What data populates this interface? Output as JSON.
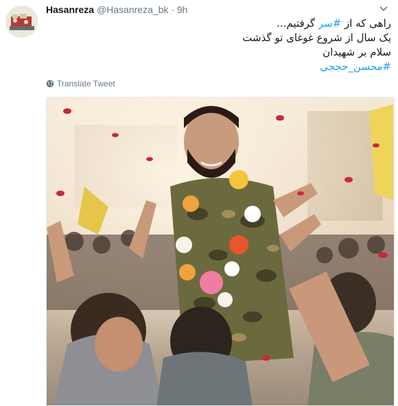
{
  "tweet": {
    "display_name": "Hasanreza",
    "handle": "@Hasanreza_bk",
    "separator": "·",
    "time": "9h",
    "text_lines": [
      {
        "before": "راهی که از ",
        "hashtag": "#سر",
        "after": " گرفتیم..."
      },
      {
        "before": "یک سال از شروع غوغای تو گذشت",
        "hashtag": "",
        "after": ""
      },
      {
        "before": "سلام بر شهیدان",
        "hashtag": "",
        "after": ""
      },
      {
        "before": "",
        "hashtag": "#محسن_حججی",
        "after": ""
      }
    ],
    "translate_label": "Translate Tweet"
  },
  "icons": {
    "caret": "chevron-down-icon",
    "globe": "globe-icon"
  },
  "colors": {
    "link": "#1da1f2",
    "secondary_text": "#657786",
    "primary_text": "#14171a"
  }
}
